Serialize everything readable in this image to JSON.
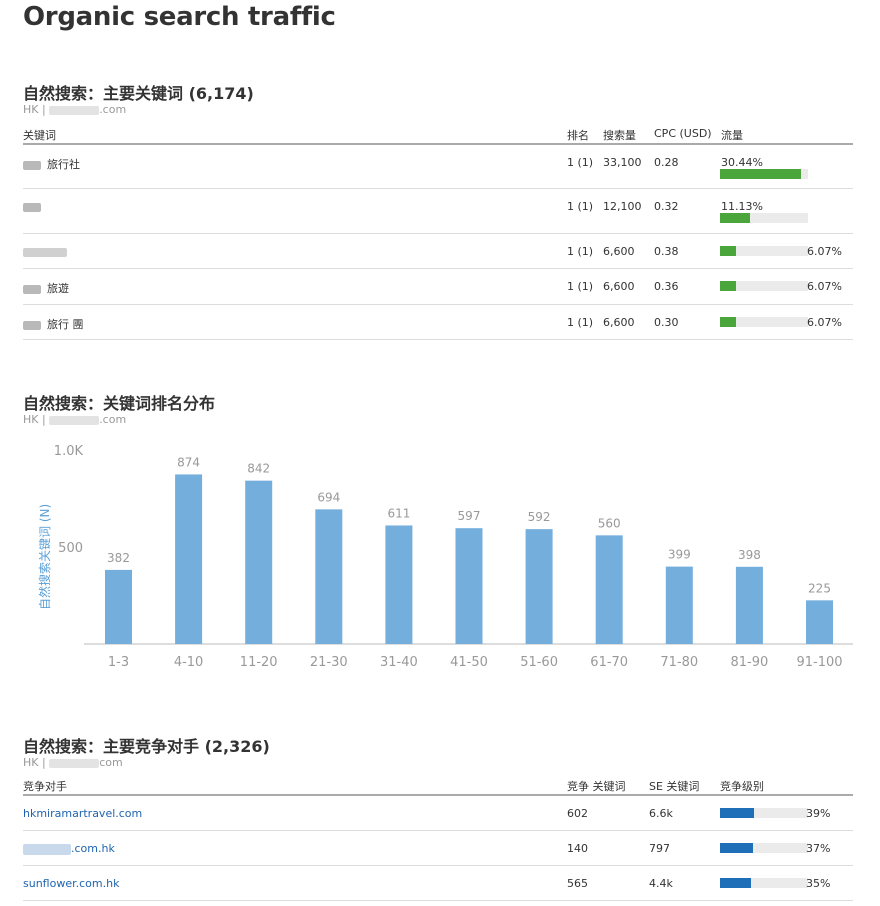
{
  "page_title": "Organic search traffic",
  "keywords_section": {
    "title": "自然搜索：主要关键词 (6,174)",
    "region": "HK |",
    "domain_suffix": ".com",
    "headers": {
      "keyword": "关键词",
      "rank": "排名",
      "volume": "搜索量",
      "cpc": "CPC (USD)",
      "traffic": "流量"
    },
    "rows": [
      {
        "keyword": "旅行社",
        "rank": "1 (1)",
        "volume": "33,100",
        "cpc": "0.28",
        "traffic": "30.44%",
        "traffic_value": 30.44
      },
      {
        "keyword": "",
        "rank": "1 (1)",
        "volume": "12,100",
        "cpc": "0.32",
        "traffic": "11.13%",
        "traffic_value": 11.13
      },
      {
        "keyword": "",
        "rank": "1 (1)",
        "volume": "6,600",
        "cpc": "0.38",
        "traffic": "6.07%",
        "traffic_value": 6.07
      },
      {
        "keyword": "旅遊",
        "rank": "1 (1)",
        "volume": "6,600",
        "cpc": "0.36",
        "traffic": "6.07%",
        "traffic_value": 6.07
      },
      {
        "keyword": "旅行 團",
        "rank": "1 (1)",
        "volume": "6,600",
        "cpc": "0.30",
        "traffic": "6.07%",
        "traffic_value": 6.07
      }
    ],
    "bar_color": "#4aa63a"
  },
  "distribution_section": {
    "title": "自然搜索：关键词排名分布",
    "region": "HK |",
    "domain_suffix": ".com"
  },
  "chart_data": {
    "type": "bar",
    "categories": [
      "1-3",
      "4-10",
      "11-20",
      "21-30",
      "31-40",
      "41-50",
      "51-60",
      "61-70",
      "71-80",
      "81-90",
      "91-100"
    ],
    "values": [
      382,
      874,
      842,
      694,
      611,
      597,
      592,
      560,
      399,
      398,
      225
    ],
    "ylabel": "自然搜索关键词 (N)",
    "yticks": [
      500,
      1000
    ],
    "ytick_labels": [
      "500",
      "1.0K"
    ],
    "ylim": [
      0,
      1000
    ],
    "bar_color": "#74aedd",
    "grid": false
  },
  "competitors_section": {
    "title": "自然搜索：主要竞争对手 (2,326)",
    "region": "HK |",
    "domain_suffix": "com",
    "headers": {
      "competitor": "竞争对手",
      "common": "竞争 关键词",
      "se": "SE 关键词",
      "level": "竞争级别"
    },
    "rows": [
      {
        "name": "hkmiramartravel.com",
        "common": "602",
        "se": "6.6k",
        "level": "39%",
        "level_value": 39
      },
      {
        "name": ".com.hk",
        "common": "140",
        "se": "797",
        "level": "37%",
        "level_value": 37
      },
      {
        "name": "sunflower.com.hk",
        "common": "565",
        "se": "4.4k",
        "level": "35%",
        "level_value": 35
      }
    ],
    "bar_color": "#1e6fb8"
  }
}
